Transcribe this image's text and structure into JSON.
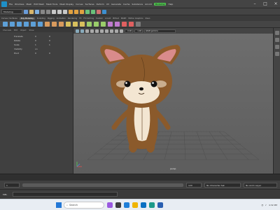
{
  "menubar": {
    "items": [
      "File",
      "Windows",
      "Mesh",
      "Edit Mesh",
      "Mesh Tools",
      "Mesh Display",
      "Curves",
      "Surfaces",
      "Deform",
      "UV",
      "Generate",
      "Cache",
      "Substance",
      "Arnold"
    ],
    "workspace_label": "Modeling",
    "trailing_items": [
      "Help"
    ]
  },
  "statusline": {
    "mode": "Modeling"
  },
  "shelf": {
    "tabs": [
      "Curves / Surfaces",
      "Poly Modeling",
      "Sculpting",
      "Rigging",
      "Animation",
      "Rendering",
      "FX",
      "FX Caching",
      "Custom",
      "Arnold",
      "Bifrost",
      "MASH",
      "Motion Graphics",
      "XGen"
    ]
  },
  "leftpanel": {
    "tabs": [
      "Channels",
      "Edit",
      "Object",
      "Show"
    ],
    "channels": [
      {
        "name": "Translate",
        "v1": "0",
        "v2": "0"
      },
      {
        "name": "Rotate",
        "v1": "0",
        "v2": "0"
      },
      {
        "name": "Scale",
        "v1": "1",
        "v2": "1"
      },
      {
        "name": "Visibility",
        "v1": "on",
        "v2": ""
      },
      {
        "name": "Pivot",
        "v1": "0",
        "v2": "0"
      }
    ]
  },
  "viewport": {
    "menu": [
      "View",
      "Shading",
      "Lighting",
      "Show",
      "Renderer",
      "Panels"
    ],
    "field_a": "0.00",
    "field_b": "1.00",
    "color_space": "sRGB gamma",
    "camera_label": "persp"
  },
  "rangebar": {
    "start": "1",
    "end": "120",
    "character_set": "No Character Set",
    "anim_layer": "No Anim Layer"
  },
  "cmdline": {
    "label": "MEL"
  },
  "taskbar": {
    "search_placeholder": "Search",
    "tray_time": "4:32 PM"
  },
  "colors": {
    "accent_selected": "#4ec14e",
    "character_fur": "#8b5a2b",
    "character_cream": "#f3e6d2"
  }
}
